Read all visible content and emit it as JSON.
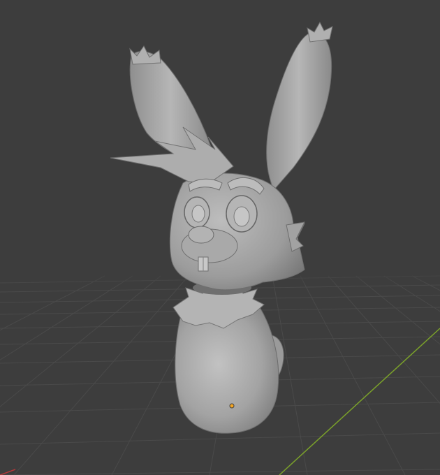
{
  "viewport": {
    "view": "3d-viewport",
    "background_color": "#3d3d3d",
    "grid_color": "#4a4a4a",
    "x_axis_color": "#b4383a",
    "y_axis_color": "#7ba22a",
    "origin_dot_color": "#f5a623",
    "model": {
      "name": "rabbit-bust-sculpt",
      "shading": "solid",
      "base_color": "#a7a7a7"
    }
  }
}
